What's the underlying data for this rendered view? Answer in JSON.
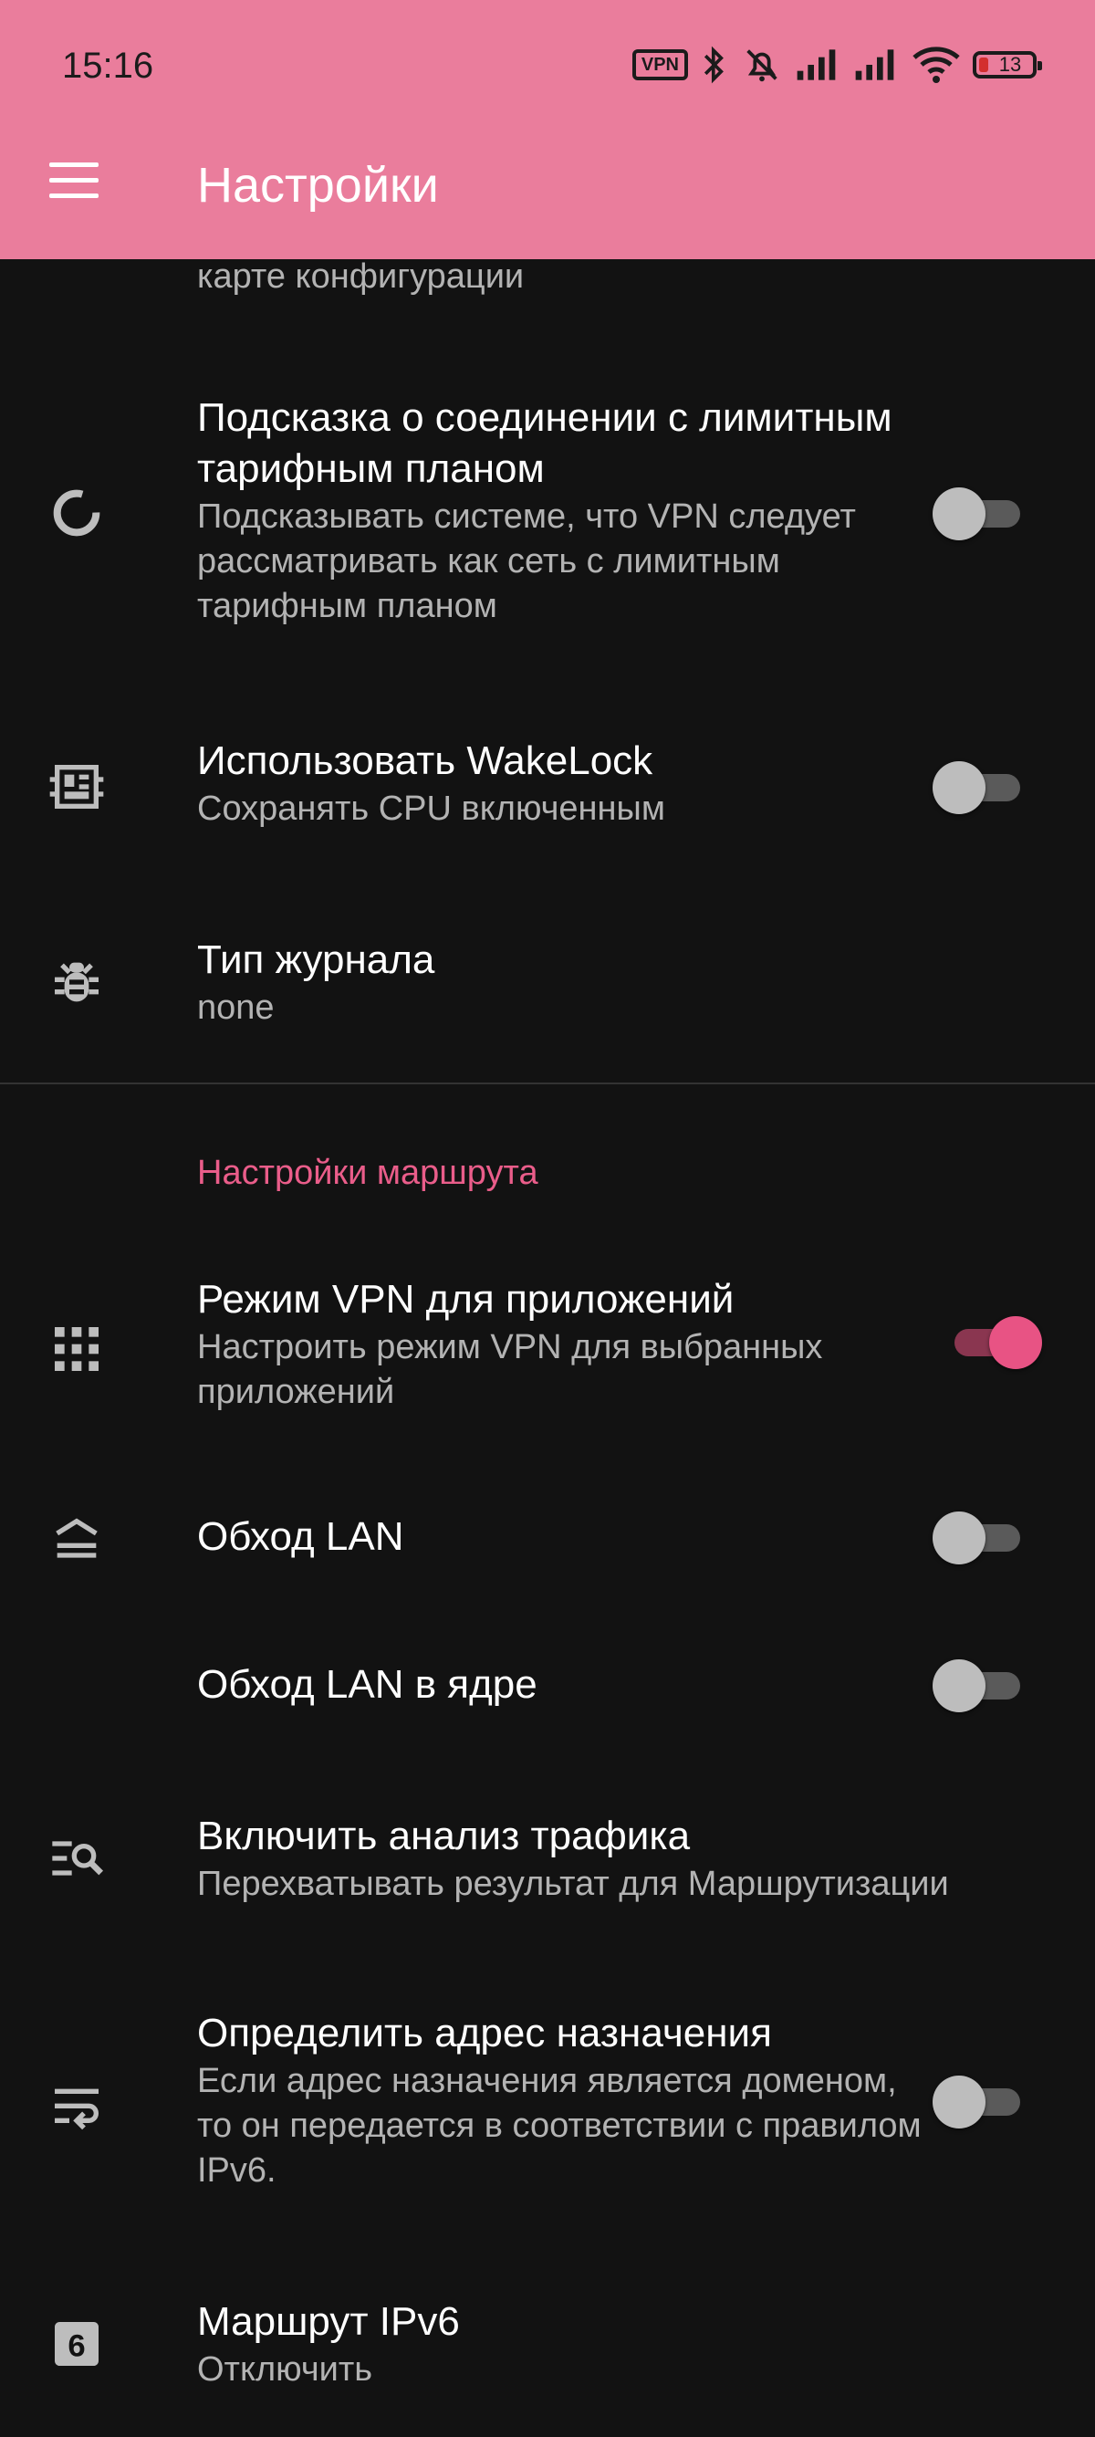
{
  "status": {
    "time": "15:16",
    "vpn": "VPN",
    "battery": "13"
  },
  "header": {
    "title": "Настройки"
  },
  "partial_text": "карте конфигурации",
  "items": [
    {
      "title": "Подсказка о соединении с лимитным тарифным планом",
      "subtitle": "Подсказывать системе, что VPN следует рассматривать как сеть с лимитным тарифным планом",
      "toggle": false,
      "icon": "progress-icon"
    },
    {
      "title": "Использовать WakeLock",
      "subtitle": "Сохранять CPU включенным",
      "toggle": false,
      "icon": "chip-icon"
    },
    {
      "title": "Тип журнала",
      "subtitle": "none",
      "icon": "bug-icon"
    }
  ],
  "section": {
    "title": "Настройки маршрута"
  },
  "route_items": [
    {
      "title": "Режим VPN для приложений",
      "subtitle": "Настроить режим VPN для выбранных приложений",
      "toggle": true,
      "icon": "apps-grid-icon"
    },
    {
      "title": "Обход LAN",
      "toggle": false,
      "icon": "lan-icon"
    },
    {
      "title": "Обход LAN в ядре",
      "toggle": false
    },
    {
      "title": "Включить анализ трафика",
      "subtitle": "Перехватывать результат для Маршрутизации",
      "icon": "manage-search-icon"
    },
    {
      "title": "Определить адрес назначения",
      "subtitle": "Если адрес назначения является доменом, то он передается в соответствии с правилом IPv6.",
      "toggle": false,
      "icon": "wrap-text-icon"
    },
    {
      "title": "Маршрут IPv6",
      "subtitle": "Отключить",
      "icon": "six-icon"
    }
  ]
}
